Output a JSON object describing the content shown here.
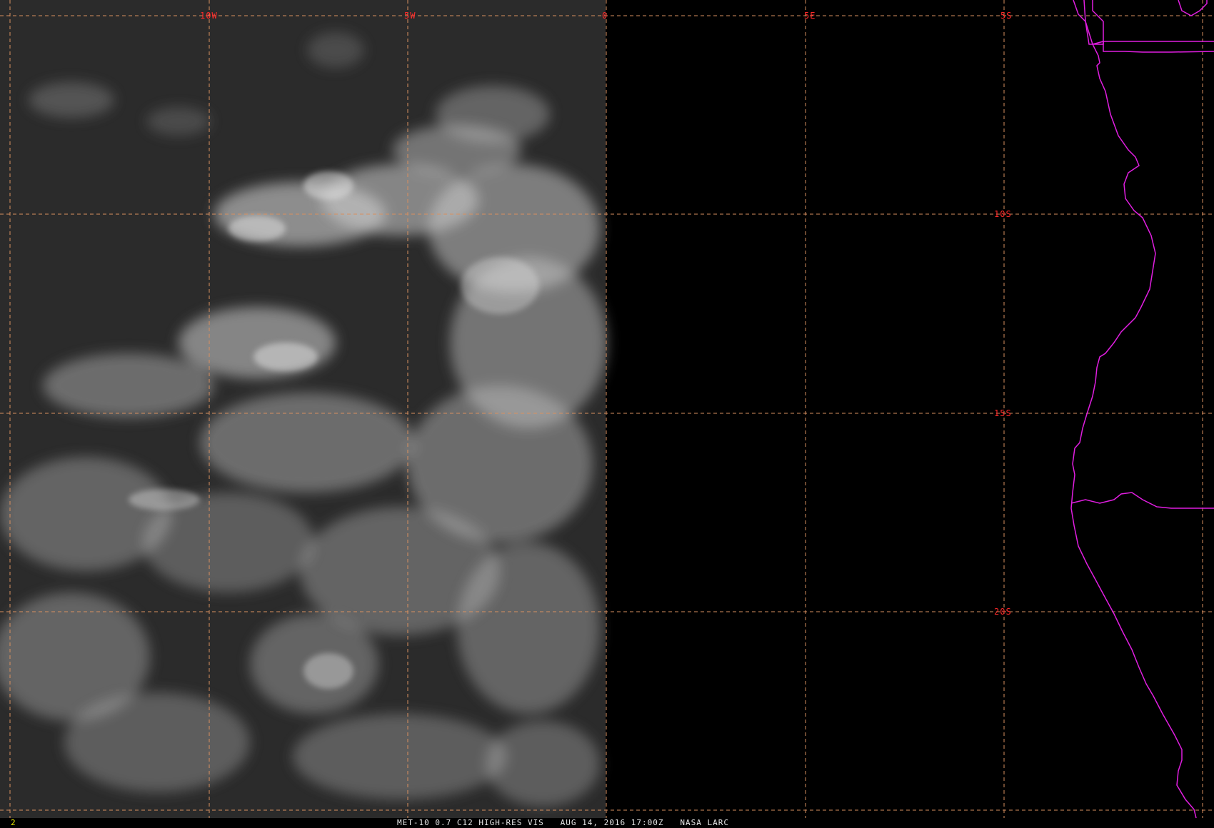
{
  "map": {
    "longitude_labels": [
      "10W",
      "5W",
      "0",
      "5E"
    ],
    "latitude_labels": [
      "5S",
      "10S",
      "15S",
      "20S"
    ],
    "colors": {
      "background": "#000000",
      "gridline": "#d9905f",
      "grid_label": "#ff2a2a",
      "coastline": "#e01ee0",
      "cloud": "#d8d8d8",
      "ocean_imagery": "#2e2e2e"
    }
  },
  "footer": {
    "frame_number": "2",
    "caption": "MET-10 0.7 C12 HIGH-RES VIS   AUG 14, 2016 17:00Z   NASA LARC",
    "frame_color": "#e6e600",
    "caption_color": "#e6e6e6"
  }
}
